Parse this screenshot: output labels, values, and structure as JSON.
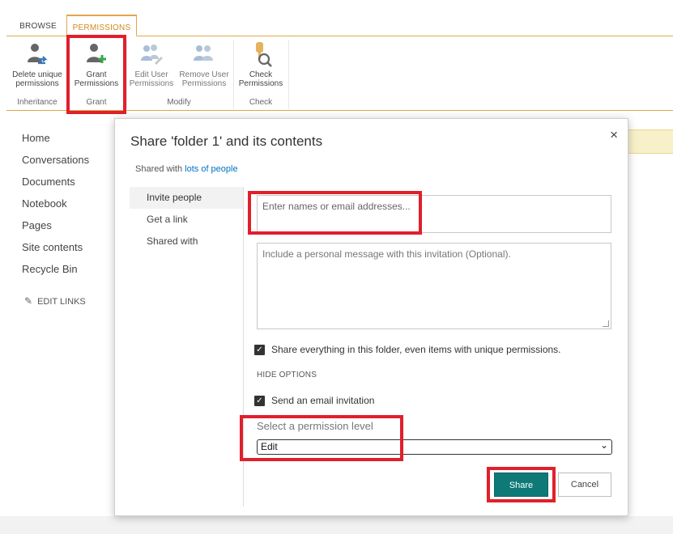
{
  "ribbon": {
    "tabs": [
      {
        "label": "BROWSE"
      },
      {
        "label": "PERMISSIONS"
      }
    ],
    "buttons": {
      "delete_unique": "Delete unique permissions",
      "grant": "Grant Permissions",
      "edit_user": "Edit User Permissions",
      "remove_user": "Remove User Permissions",
      "check": "Check Permissions"
    },
    "groups": {
      "inheritance": "Inheritance",
      "grant": "Grant",
      "modify": "Modify",
      "check": "Check"
    }
  },
  "nav": {
    "items": [
      "Home",
      "Conversations",
      "Documents",
      "Notebook",
      "Pages",
      "Site contents",
      "Recycle Bin"
    ],
    "edit_links": "EDIT LINKS"
  },
  "dialog": {
    "title": "Share 'folder 1' and its contents",
    "close": "×",
    "shared_with_prefix": "Shared with",
    "shared_with_link": "lots of people",
    "nav": [
      "Invite people",
      "Get a link",
      "Shared with"
    ],
    "names_placeholder": "Enter names or email addresses...",
    "message_placeholder": "Include a personal message with this invitation (Optional).",
    "share_everything_label": "Share everything in this folder, even items with unique permissions.",
    "share_everything_checked": true,
    "hide_options": "HIDE OPTIONS",
    "send_email_label": "Send an email invitation",
    "send_email_checked": true,
    "permission_label": "Select a permission level",
    "permission_value": "Edit",
    "share_button": "Share",
    "cancel_button": "Cancel"
  },
  "colors": {
    "accent": "#e2a64c",
    "highlight_box": "#e0202b",
    "share_button": "#0e7a78",
    "link": "#0072c6"
  }
}
